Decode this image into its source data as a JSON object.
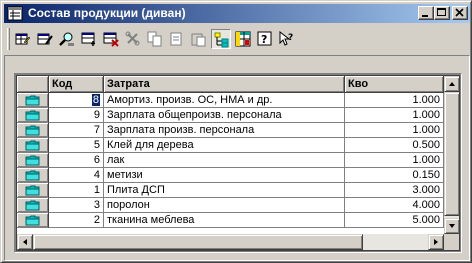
{
  "window": {
    "title": "Состав продукции (диван)"
  },
  "toolbar": {
    "buttons": [
      {
        "icon": "grid-edit-icon"
      },
      {
        "icon": "grid-props-icon"
      },
      {
        "icon": "magnifier-icon"
      },
      {
        "icon": "table-insert-icon"
      },
      {
        "icon": "table-delete-icon"
      },
      {
        "icon": "tools-icon"
      },
      {
        "icon": "copy-icon"
      },
      {
        "icon": "paste-icon"
      },
      {
        "icon": "clipboard-icon"
      },
      {
        "icon": "tree-view-icon"
      },
      {
        "icon": "grid-view-icon"
      },
      {
        "icon": "help-icon"
      },
      {
        "icon": "context-help-icon"
      }
    ]
  },
  "table": {
    "columns": [
      "Код",
      "Затрата",
      "Кво"
    ],
    "rows": [
      {
        "code": "8",
        "name": "Амортиз. произв. ОС, НМА и др.",
        "qty": "1.000",
        "selected": true
      },
      {
        "code": "9",
        "name": "Зарплата общепроизв. персонала",
        "qty": "1.000"
      },
      {
        "code": "7",
        "name": "Зарплата произв. персонала",
        "qty": "1.000"
      },
      {
        "code": "5",
        "name": "Клей для дерева",
        "qty": "0.500"
      },
      {
        "code": "6",
        "name": "лак",
        "qty": "1.000"
      },
      {
        "code": "4",
        "name": "метизи",
        "qty": "0.150"
      },
      {
        "code": "1",
        "name": "Плита ДСП",
        "qty": "3.000"
      },
      {
        "code": "3",
        "name": "поролон",
        "qty": "4.000"
      },
      {
        "code": "2",
        "name": "тканина  меблева",
        "qty": "5.000"
      }
    ]
  },
  "colors": {
    "titlebar_start": "#0a246a",
    "titlebar_end": "#a6caf0",
    "selection": "#0a246a",
    "face": "#d4d0c8"
  }
}
